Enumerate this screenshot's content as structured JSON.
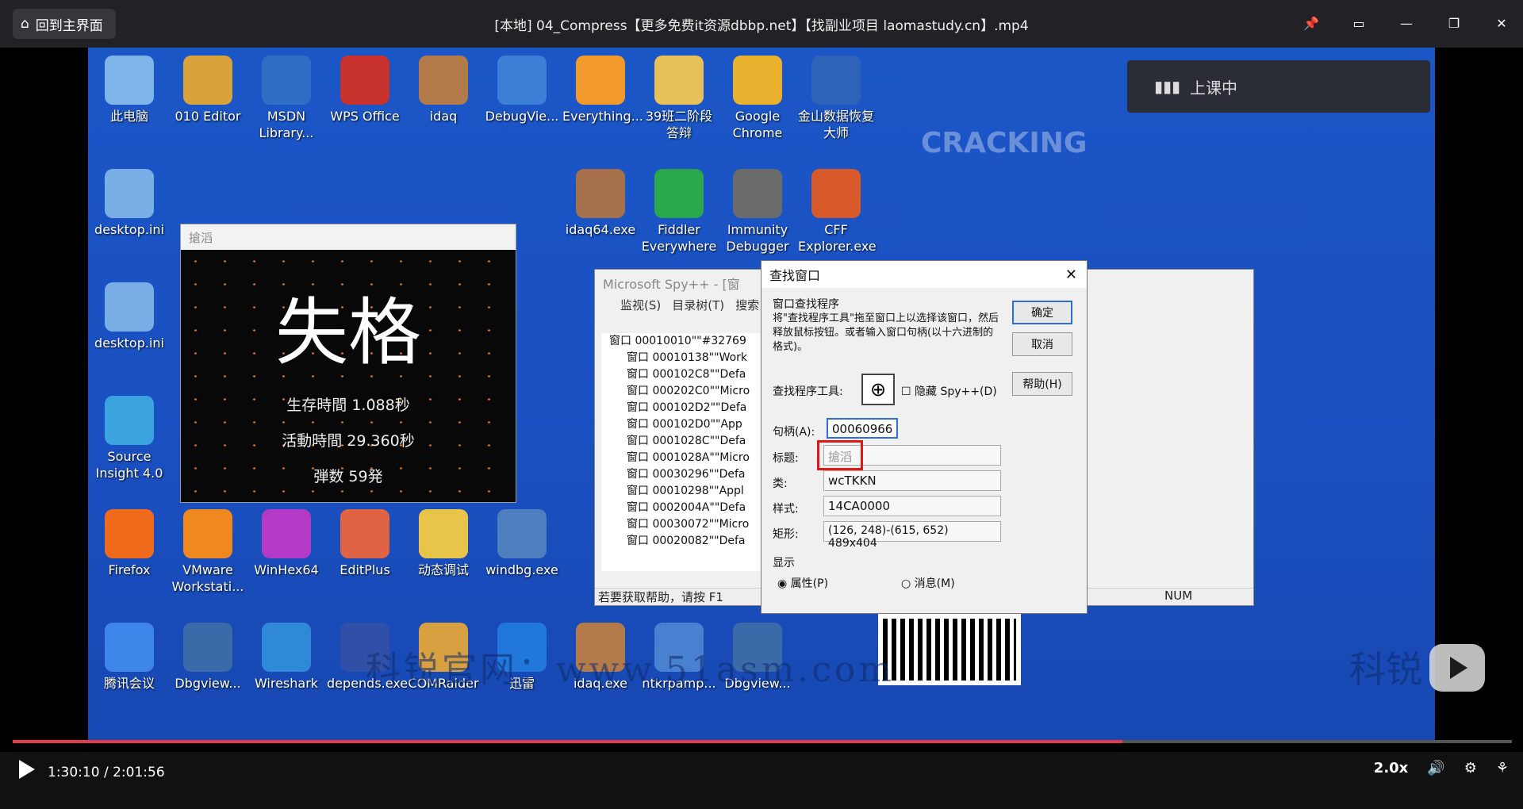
{
  "header": {
    "home_label": "回到主界面",
    "title": "[本地] 04_Compress【更多免费it资源dbbp.net】【找副业项目 laomastudy.cn】.mp4"
  },
  "desktop_icons": [
    {
      "label": "此电脑"
    },
    {
      "label": "010 Editor"
    },
    {
      "label": "MSDN Library..."
    },
    {
      "label": "WPS Office"
    },
    {
      "label": "idaq"
    },
    {
      "label": "DebugVie..."
    },
    {
      "label": "Everything..."
    },
    {
      "label": "39班二阶段答辩"
    },
    {
      "label": "Google Chrome"
    },
    {
      "label": "金山数据恢复大师"
    },
    {
      "label": "desktop.ini"
    },
    {
      "label": "Fiddler Everywhere"
    },
    {
      "label": "Immunity Debugger"
    },
    {
      "label": "CFF Explorer.exe"
    },
    {
      "label": "idaq64.exe"
    },
    {
      "label": "desktop.ini"
    },
    {
      "label": "Source Insight 4.0"
    },
    {
      "label": "Firefox"
    },
    {
      "label": "VMware Workstati..."
    },
    {
      "label": "WinHex64"
    },
    {
      "label": "EditPlus"
    },
    {
      "label": "动态调试"
    },
    {
      "label": "windbg.exe"
    },
    {
      "label": "腾讯会议"
    },
    {
      "label": "Dbgview..."
    },
    {
      "label": "Wireshark"
    },
    {
      "label": "depends.exe"
    },
    {
      "label": "COMRaider"
    },
    {
      "label": "迅雷"
    },
    {
      "label": "idaq.exe"
    },
    {
      "label": "ntkrpamp..."
    },
    {
      "label": "Dbgview..."
    }
  ],
  "classroom": {
    "label": "上课中"
  },
  "game": {
    "title": "搶滔",
    "big": "失格",
    "survive": "生存時間 1.088秒",
    "active": "活動時間 29.360秒",
    "bullets": "弾数 59発"
  },
  "spy": {
    "title": "Microsoft Spy++ - [窗",
    "menu": [
      "监视(S)",
      "目录树(T)",
      "搜索"
    ],
    "tree": [
      "窗口 00010010\"\"#32769",
      "窗口 00010138\"\"Work",
      "窗口 000102C8\"\"Defa",
      "窗口 000202C0\"\"Micro",
      "窗口 000102D2\"\"Defa",
      "窗口 000102D0\"\"App",
      "窗口 0001028C\"\"Defa",
      "窗口 0001028A\"\"Micro",
      "窗口 00030296\"\"Defa",
      "窗口 00010298\"\"Appl",
      "窗口 0002004A\"\"Defa",
      "窗口 00030072\"\"Micro",
      "窗口 00020082\"\"Defa"
    ],
    "status": "若要获取帮助，请按 F1",
    "num": "NUM"
  },
  "find": {
    "title": "查找窗口",
    "group": "窗口查找程序",
    "desc": "将\"查找程序工具\"拖至窗口上以选择该窗口，然后释放鼠标按钮。或者输入窗口句柄(以十六进制的格式)。",
    "ok": "确定",
    "cancel": "取消",
    "help": "帮助(H)",
    "tool_label": "查找程序工具:",
    "hide": "隐藏 Spy++(D)",
    "handle_label": "句柄(A):",
    "handle": "00060966",
    "caption_label": "标题:",
    "caption": "搶滔",
    "class_label": "类:",
    "class": "wcTKKN",
    "style_label": "样式:",
    "style": "14CA0000",
    "rect_label": "矩形:",
    "rect": "(126, 248)-(615, 652) 489x404",
    "show": "显示",
    "prop": "属性(P)",
    "msg": "消息(M)"
  },
  "watermark": {
    "text": "科锐官网：www.51asm.com",
    "brand": "科锐",
    "logo": "CRACKING"
  },
  "player": {
    "current": "1:30:10",
    "total": "2:01:56",
    "speed": "2.0x",
    "progress": 0.74
  },
  "colors": {
    "accent": "#e53a48"
  }
}
